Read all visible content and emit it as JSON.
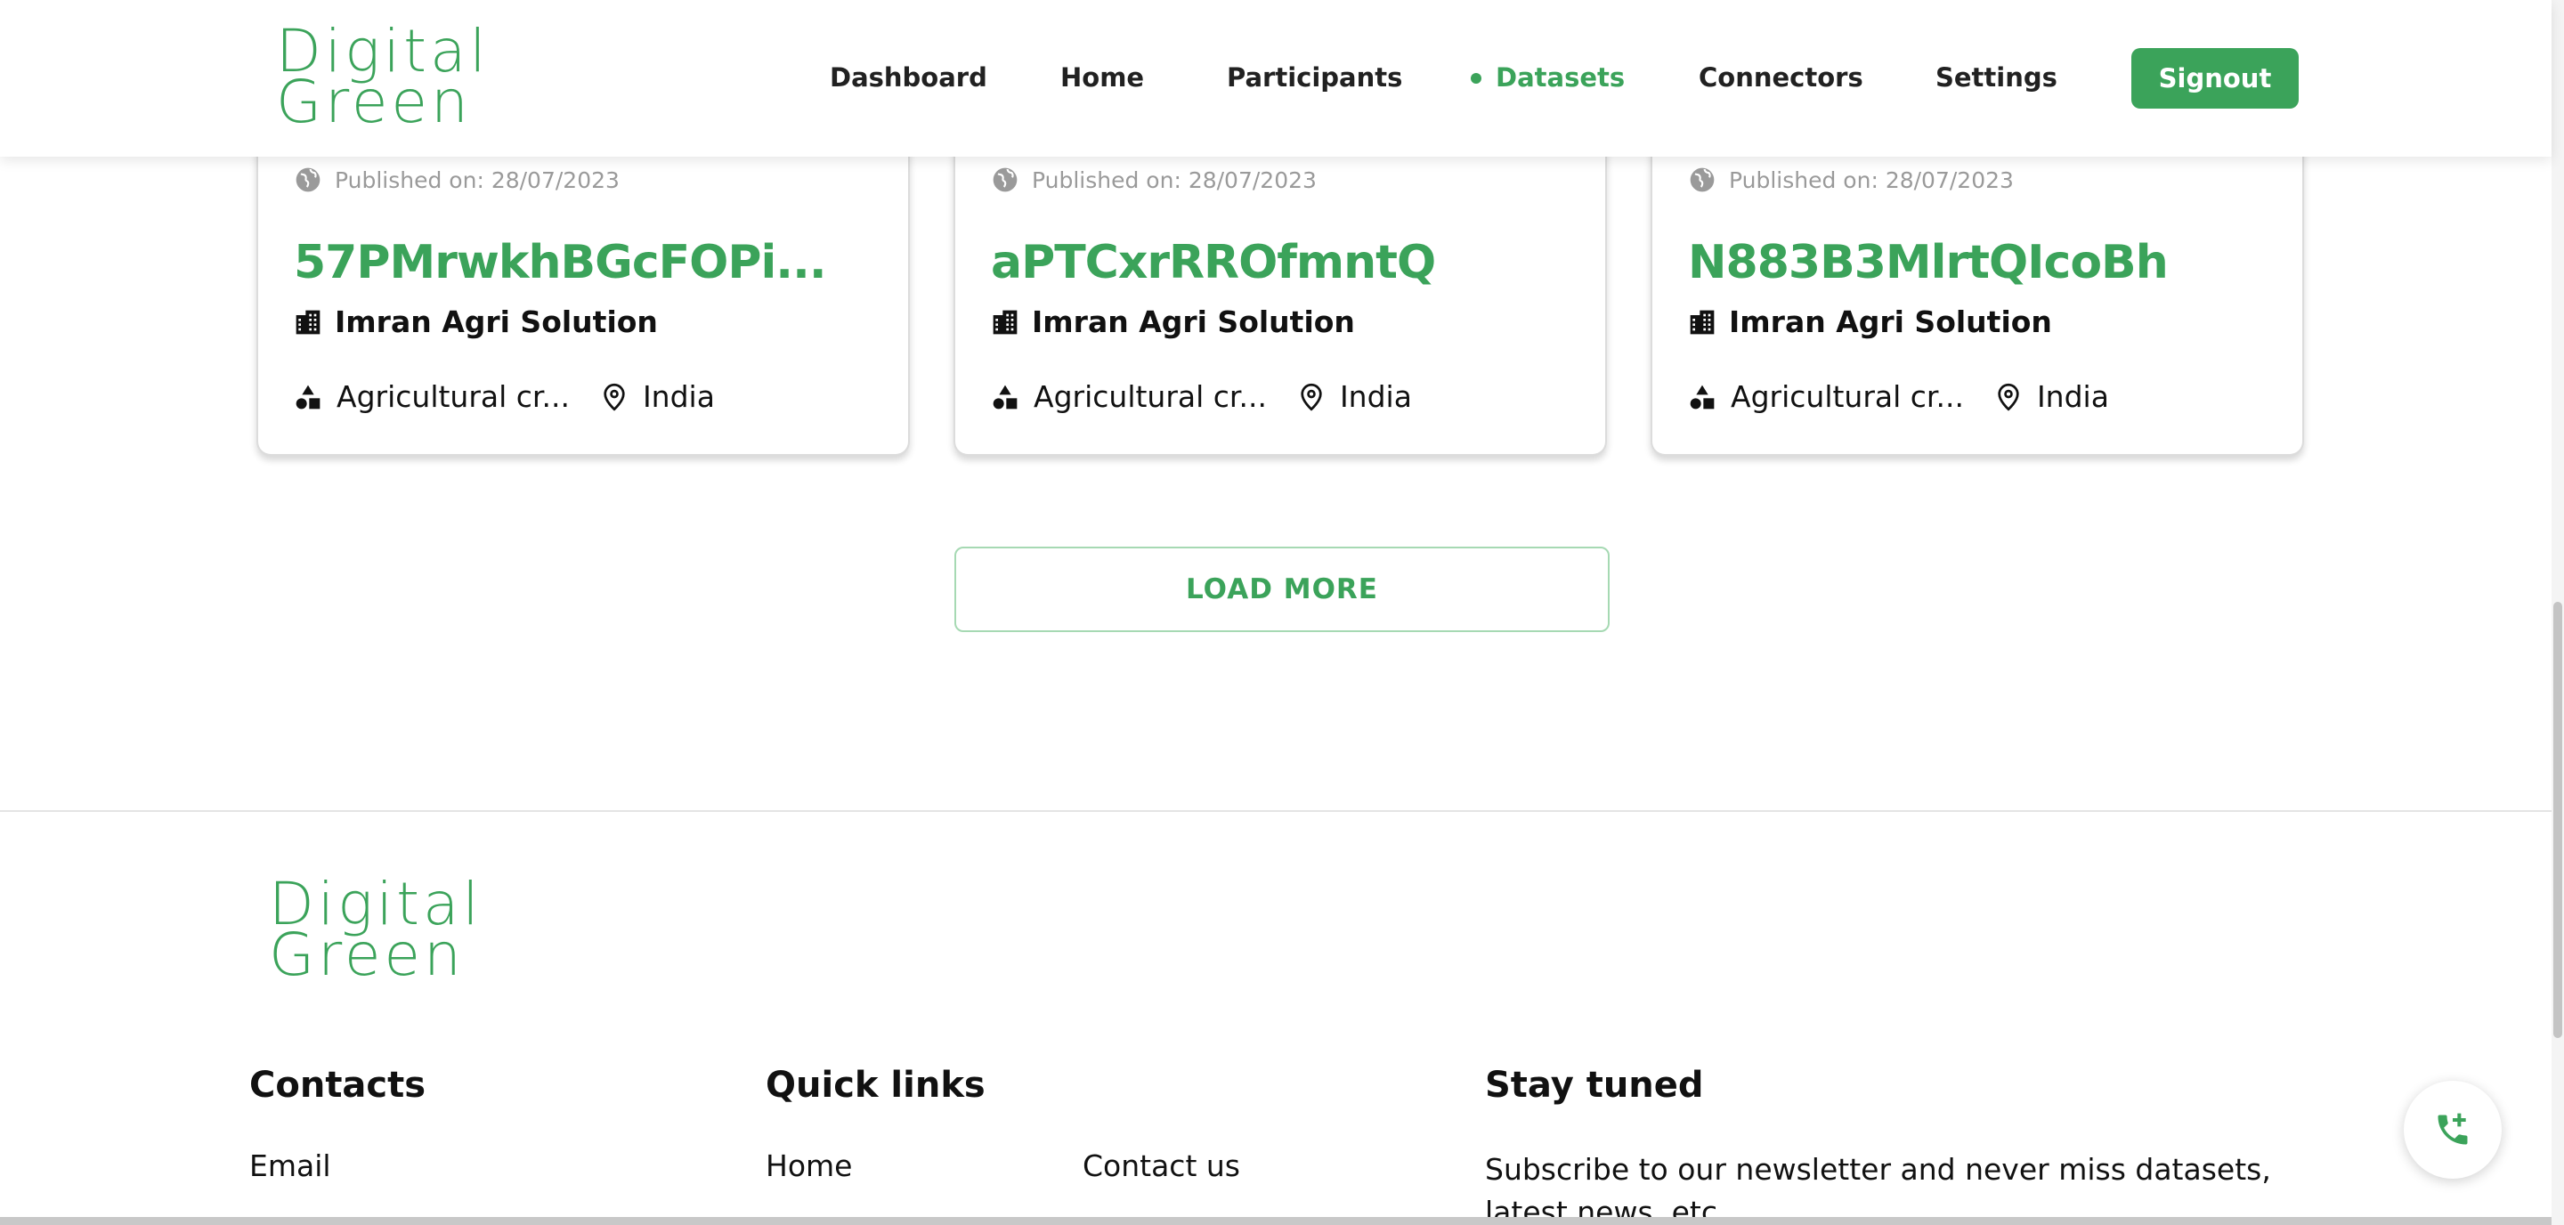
{
  "header": {
    "logo": {
      "line1": "Digital",
      "line2": "Green"
    },
    "nav": [
      "Dashboard",
      "Home",
      "Participants",
      "Datasets",
      "Connectors",
      "Settings"
    ],
    "active_nav": "Datasets",
    "signout_label": "Signout"
  },
  "cards": [
    {
      "published": "Published on: 28/07/2023",
      "title": "57PMrwkhBGcFOPi...",
      "organization": "Imran Agri Solution",
      "category": "Agricultural cr...",
      "location": "India"
    },
    {
      "published": "Published on: 28/07/2023",
      "title": "aPTCxrRROfmntQ",
      "organization": "Imran Agri Solution",
      "category": "Agricultural cr...",
      "location": "India"
    },
    {
      "published": "Published on: 28/07/2023",
      "title": "N883B3MlrtQIcoBh",
      "organization": "Imran Agri Solution",
      "category": "Agricultural cr...",
      "location": "India"
    }
  ],
  "load_more_label": "LOAD MORE",
  "footer": {
    "logo": {
      "line1": "Digital",
      "line2": "Green"
    },
    "contacts": {
      "heading": "Contacts",
      "email_label": "Email"
    },
    "quick_links": {
      "heading": "Quick links",
      "links": [
        "Home",
        "Contact us"
      ]
    },
    "stay_tuned": {
      "heading": "Stay tuned",
      "text": "Subscribe to our newsletter and never miss datasets, latest news, etc."
    }
  },
  "colors": {
    "brand_green": "#3ba35a",
    "text_dark": "#212121",
    "muted": "#9a9a9a"
  },
  "icons": [
    "globe-icon",
    "building-icon",
    "shapes-icon",
    "location-pin-icon",
    "phone-add-icon"
  ]
}
